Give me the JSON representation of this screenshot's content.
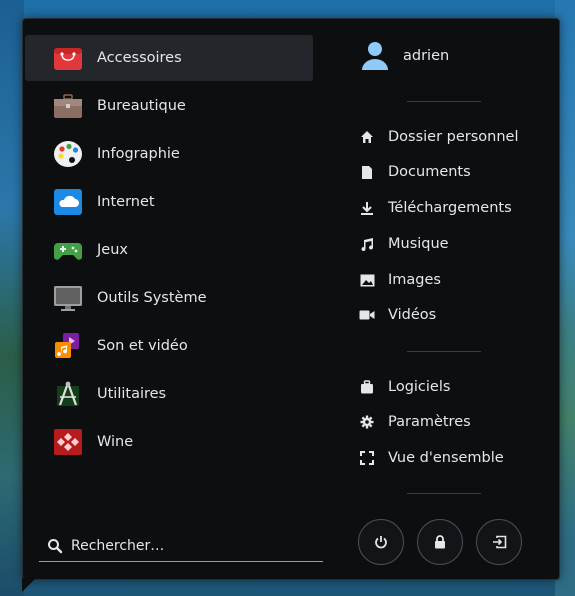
{
  "categories": [
    {
      "label": "Accessoires",
      "icon": "accessories-icon",
      "active": true
    },
    {
      "label": "Bureautique",
      "icon": "briefcase-icon",
      "active": false
    },
    {
      "label": "Infographie",
      "icon": "palette-icon",
      "active": false
    },
    {
      "label": "Internet",
      "icon": "cloud-icon",
      "active": false
    },
    {
      "label": "Jeux",
      "icon": "gamepad-icon",
      "active": false
    },
    {
      "label": "Outils Système",
      "icon": "monitor-icon",
      "active": false
    },
    {
      "label": "Son et vidéo",
      "icon": "music-video-icon",
      "active": false
    },
    {
      "label": "Utilitaires",
      "icon": "utilities-icon",
      "active": false
    },
    {
      "label": "Wine",
      "icon": "wine-icon",
      "active": false
    }
  ],
  "search": {
    "placeholder": "Rechercher…"
  },
  "user": {
    "name": "adrien"
  },
  "places": [
    {
      "label": "Dossier personnel",
      "icon": "home-icon"
    },
    {
      "label": "Documents",
      "icon": "document-icon"
    },
    {
      "label": "Téléchargements",
      "icon": "download-icon"
    },
    {
      "label": "Musique",
      "icon": "music-icon"
    },
    {
      "label": "Images",
      "icon": "image-icon"
    },
    {
      "label": "Vidéos",
      "icon": "video-icon"
    }
  ],
  "system": [
    {
      "label": "Logiciels",
      "icon": "software-icon"
    },
    {
      "label": "Paramètres",
      "icon": "settings-icon"
    },
    {
      "label": "Vue d'ensemble",
      "icon": "overview-icon"
    }
  ],
  "colors": {
    "menu_bg": "#0c0e10",
    "active_bg": "#23272b",
    "text": "#e6e6e6"
  }
}
